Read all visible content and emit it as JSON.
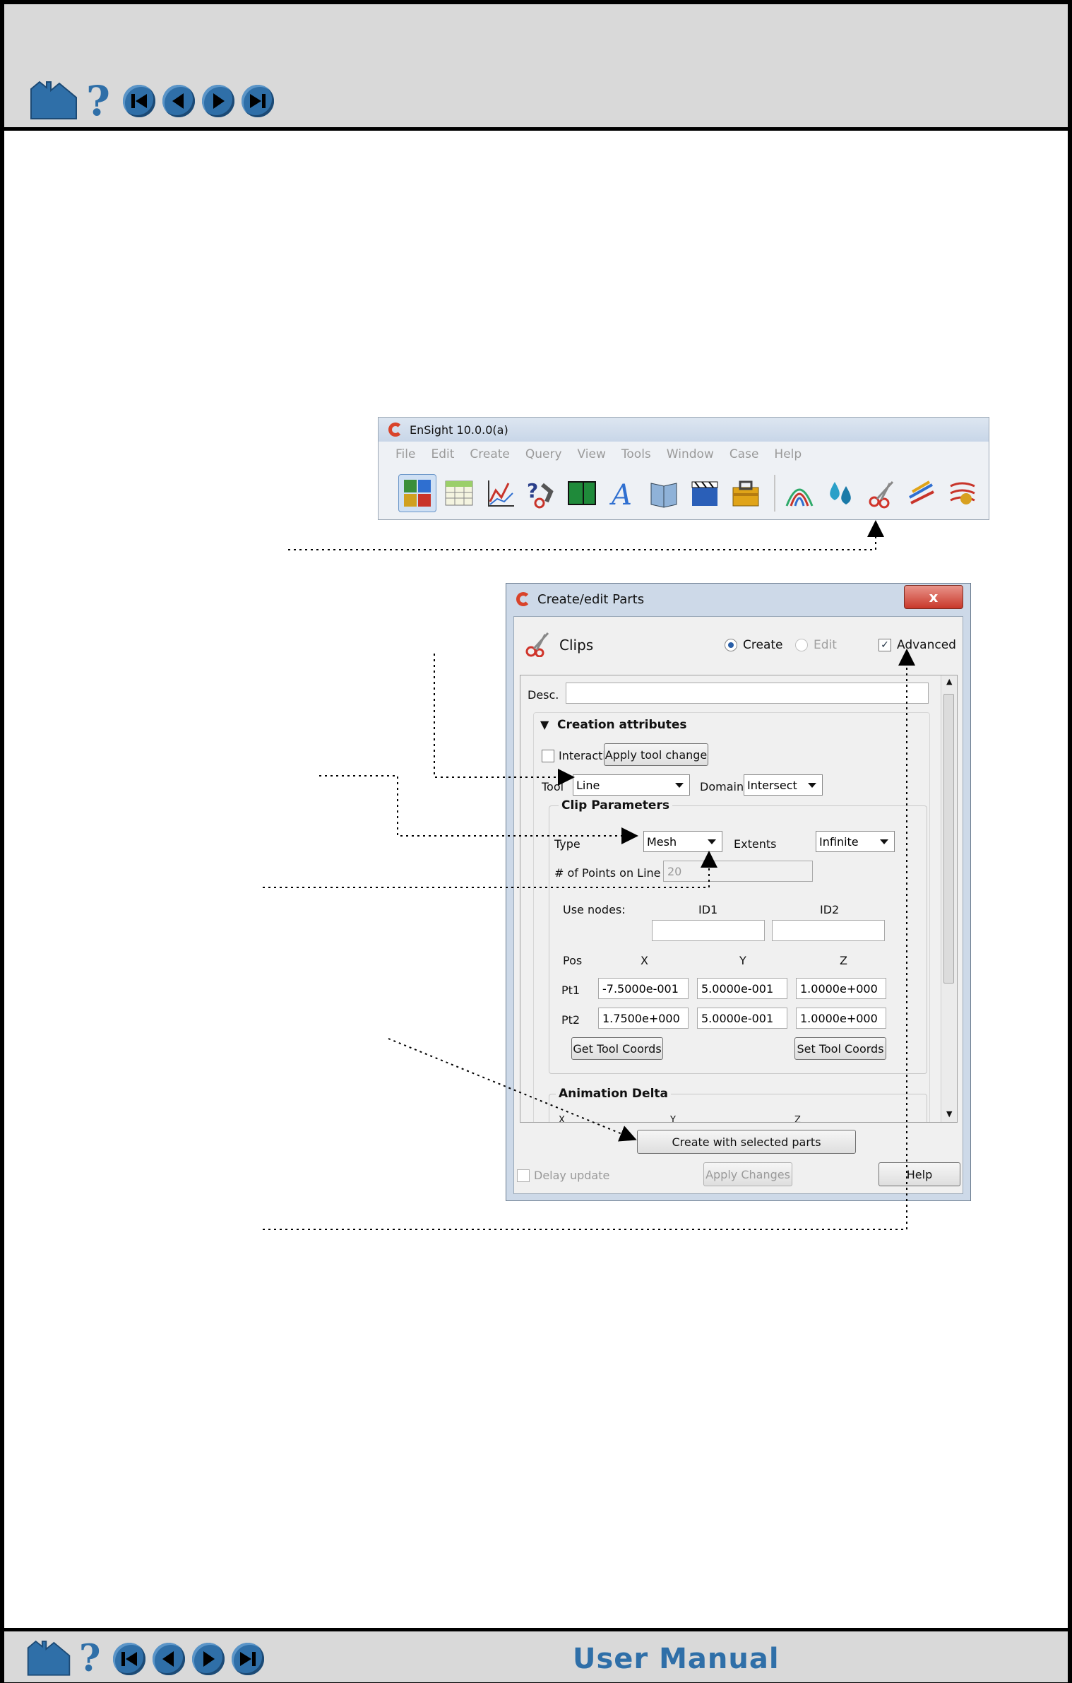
{
  "footer": {
    "title": "User Manual"
  },
  "nav_icons": [
    "home-icon",
    "help-icon",
    "first-page-icon",
    "previous-page-icon",
    "next-page-icon",
    "last-page-icon"
  ],
  "ensight_window": {
    "title": "EnSight 10.0.0(a)",
    "menu": [
      "File",
      "Edit",
      "Create",
      "Query",
      "View",
      "Tools",
      "Window",
      "Case",
      "Help"
    ]
  },
  "dialog": {
    "title": "Create/edit Parts",
    "close_label": "x",
    "feature": "Clips",
    "create_label": "Create",
    "edit_label": "Edit",
    "advanced_label": "Advanced",
    "desc_label": "Desc.",
    "desc_value": "",
    "creation_attributes": "Creation attributes",
    "interactive_label": "Interactive",
    "apply_tool_change": "Apply tool change",
    "tool_label": "Tool",
    "tool_value": "Line",
    "domain_label": "Domain",
    "domain_value": "Intersect",
    "clip_parameters": "Clip Parameters",
    "type_label": "Type",
    "type_value": "Mesh",
    "extents_label": "Extents",
    "extents_value": "Infinite",
    "points_label": "# of Points on Line",
    "points_value": "20",
    "use_nodes_label": "Use nodes:",
    "id1_label": "ID1",
    "id2_label": "ID2",
    "pos_label": "Pos",
    "x_label": "X",
    "y_label": "Y",
    "z_label": "Z",
    "pt1_label": "Pt1",
    "pt1": [
      "-7.5000e-001",
      "5.0000e-001",
      "1.0000e+000"
    ],
    "pt2_label": "Pt2",
    "pt2": [
      "1.7500e+000",
      "5.0000e-001",
      "1.0000e+000"
    ],
    "get_tool_coords": "Get Tool Coords",
    "set_tool_coords": "Set Tool Coords",
    "animation_delta": "Animation Delta",
    "anim_x": "X",
    "anim_y": "Y",
    "anim_z": "Z",
    "create_button": "Create with selected parts",
    "delay_update": "Delay update",
    "apply_changes": "Apply Changes",
    "help": "Help"
  }
}
